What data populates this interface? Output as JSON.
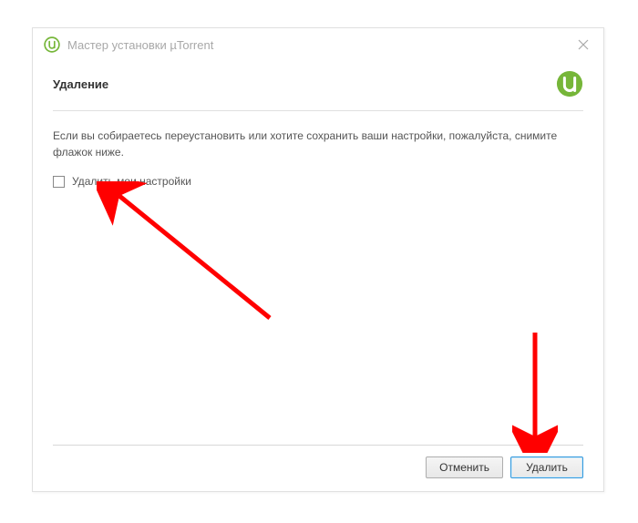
{
  "window": {
    "title": "Мастер установки µTorrent"
  },
  "header": {
    "title": "Удаление"
  },
  "content": {
    "description": "Если вы собираетесь переустановить или хотите сохранить ваши настройки, пожалуйста, снимите флажок ниже.",
    "checkbox_label": "Удалить мои настройки",
    "checkbox_checked": false
  },
  "footer": {
    "cancel_label": "Отменить",
    "delete_label": "Удалить"
  },
  "colors": {
    "brand_green": "#76b639",
    "arrow_red": "#ff0000"
  }
}
